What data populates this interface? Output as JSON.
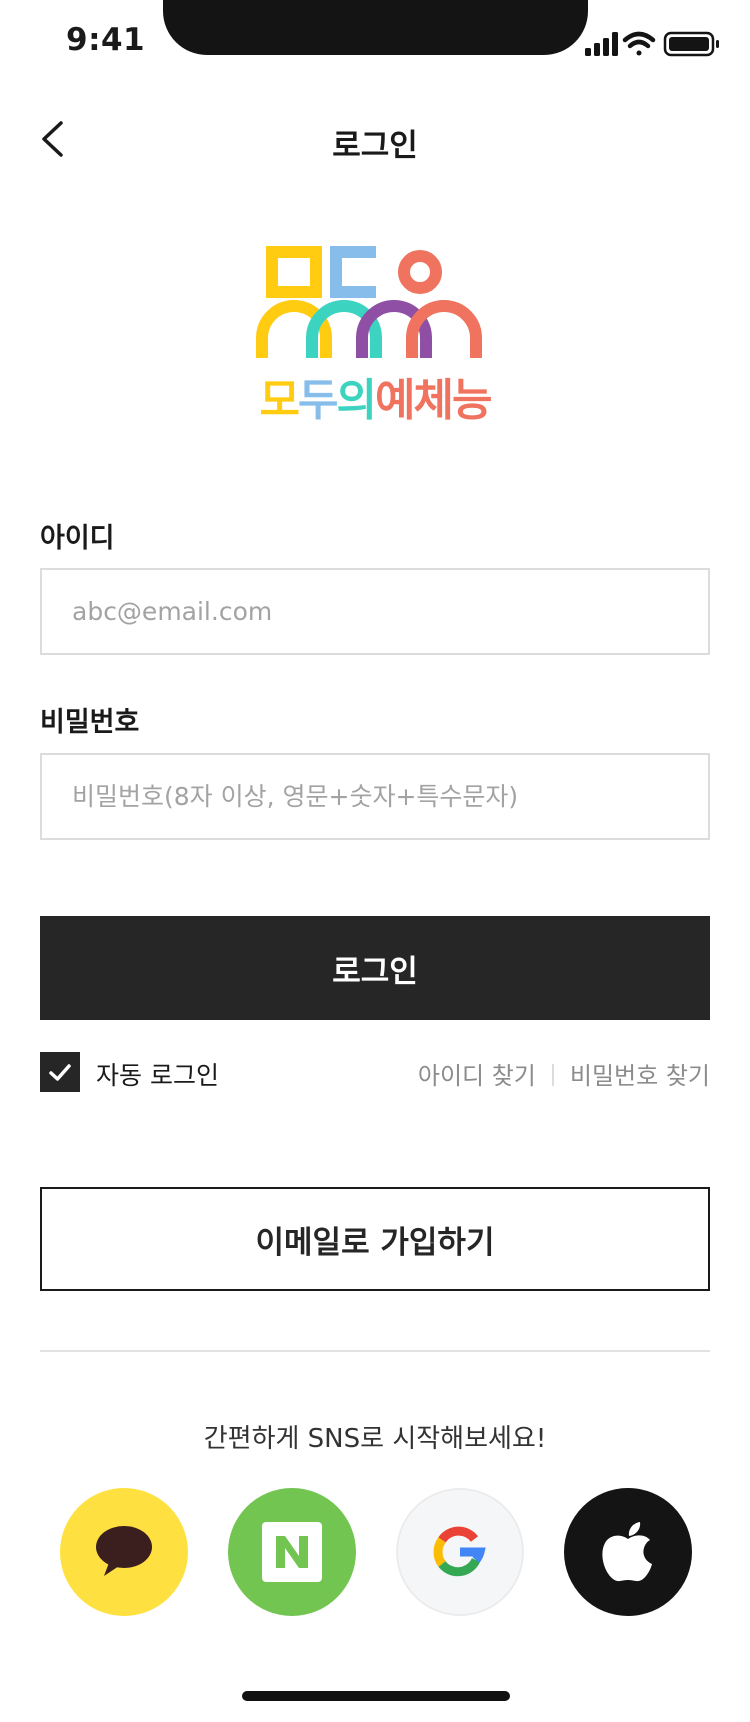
{
  "status_bar": {
    "time": "9:41"
  },
  "nav": {
    "title": "로그인"
  },
  "logo": {
    "text": "모두의예체능"
  },
  "form": {
    "id_label": "아이디",
    "id_placeholder": "abc@email.com",
    "password_label": "비밀번호",
    "password_placeholder": "비밀번호(8자 이상, 영문+숫자+특수문자)",
    "login_button": "로그인",
    "auto_login_label": "자동 로그인",
    "auto_login_checked": true,
    "find_id_link": "아이디 찾기",
    "find_password_link": "비밀번호 찾기"
  },
  "signup": {
    "email_signup_button": "이메일로 가입하기"
  },
  "sns": {
    "prompt": "간편하게 SNS로 시작해보세요!",
    "providers": [
      {
        "name": "kakao",
        "icon": "kakao-icon",
        "color": "#FEE140"
      },
      {
        "name": "naver",
        "icon": "naver-icon",
        "color": "#72C551"
      },
      {
        "name": "google",
        "icon": "google-icon",
        "color": "#F5F6F8"
      },
      {
        "name": "apple",
        "icon": "apple-icon",
        "color": "#141414"
      }
    ]
  },
  "colors": {
    "primary": "#262626",
    "logo_yellow": "#FFCC11",
    "logo_blue": "#87BDEB",
    "logo_teal": "#3CD4C0",
    "logo_purple": "#8E4FA4",
    "logo_coral": "#EF735F"
  }
}
